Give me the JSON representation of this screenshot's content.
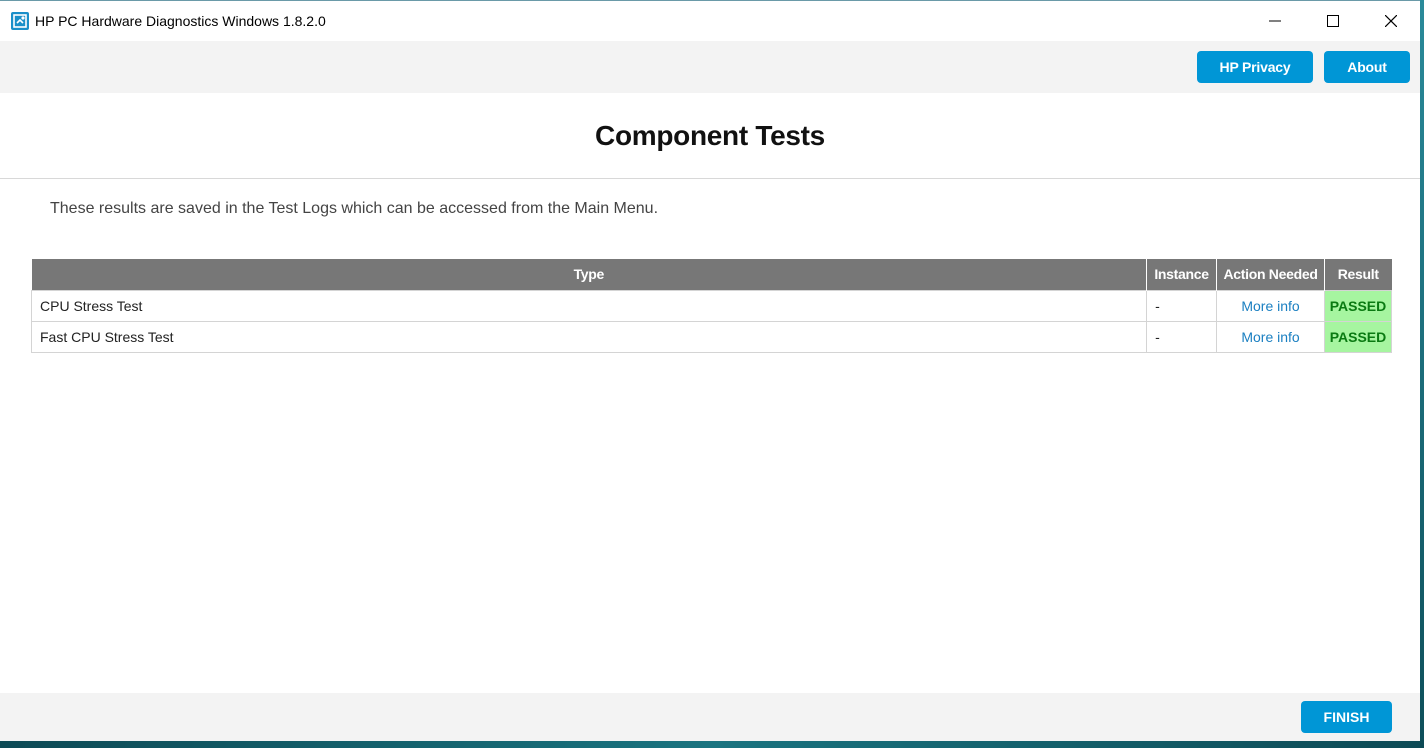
{
  "window": {
    "title": "HP PC Hardware Diagnostics Windows 1.8.2.0",
    "icon": "hp-diagnostics-app-icon",
    "controls": [
      "minimize-icon",
      "maximize-icon",
      "close-icon"
    ]
  },
  "header": {
    "privacy_label": "HP Privacy",
    "about_label": "About"
  },
  "page": {
    "title": "Component Tests",
    "notice": "These results are saved in the Test Logs which can be accessed from the Main Menu."
  },
  "table": {
    "headers": {
      "type": "Type",
      "instance": "Instance",
      "action": "Action Needed",
      "result": "Result"
    },
    "rows": [
      {
        "type": "CPU Stress Test",
        "instance": "-",
        "action": "More info",
        "result": "PASSED"
      },
      {
        "type": "Fast CPU Stress Test",
        "instance": "-",
        "action": "More info",
        "result": "PASSED"
      }
    ]
  },
  "footer": {
    "finish_label": "FINISH"
  },
  "colors": {
    "accent": "#0096d6",
    "table_header": "#777777",
    "passed_bg": "#a6f5a0",
    "passed_text": "#0a7a12",
    "link": "#1a7fc1"
  }
}
